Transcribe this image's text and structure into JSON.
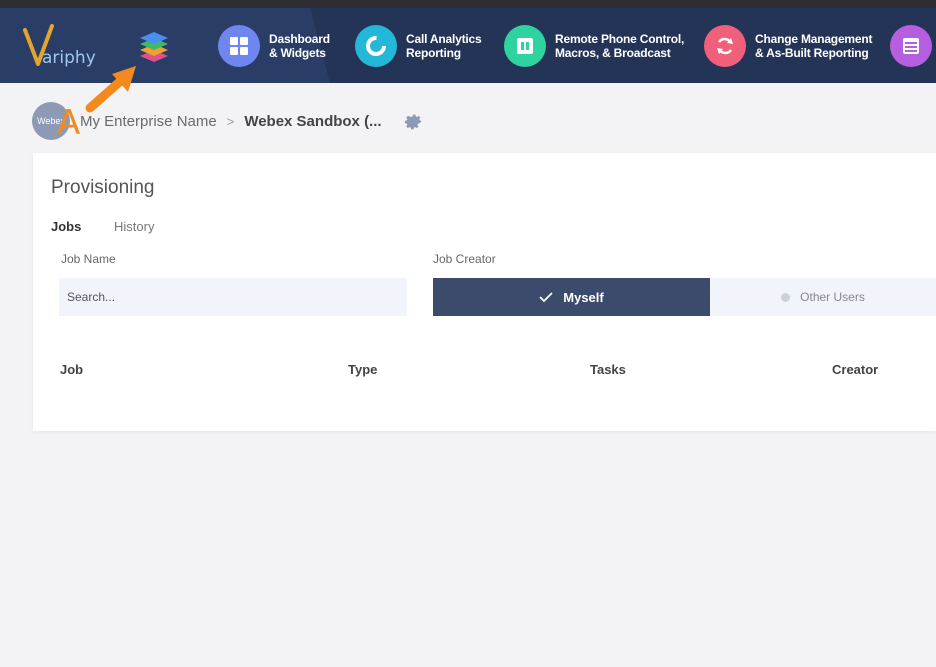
{
  "brand": {
    "logo_text": "ariphy",
    "logo_initial": "V"
  },
  "nav": {
    "items": [
      {
        "line1": "Dashboard",
        "line2": "& Widgets",
        "icon": "dashboard-icon",
        "color": "#6f86f0"
      },
      {
        "line1": "Call Analytics",
        "line2": "Reporting",
        "icon": "analytics-icon",
        "color": "#24b8d8"
      },
      {
        "line1": "Remote Phone Control,",
        "line2": "Macros, & Broadcast",
        "icon": "phone-control-icon",
        "color": "#2fd3a0"
      },
      {
        "line1": "Change Management",
        "line2": "& As-Built Reporting",
        "icon": "change-management-icon",
        "color": "#f0607a"
      },
      {
        "line1": "",
        "line2": "",
        "icon": "table-icon",
        "color": "#b65ee0"
      }
    ]
  },
  "breadcrumb": {
    "avatar_text": "Webex",
    "enterprise": "My Enterprise Name",
    "separator": ">",
    "current": "Webex Sandbox (..."
  },
  "annotation": {
    "label": "A",
    "color": "#f28a1e"
  },
  "provisioning": {
    "title": "Provisioning",
    "tabs": {
      "jobs": "Jobs",
      "history": "History"
    },
    "job_name_label": "Job Name",
    "search_placeholder": "Search...",
    "job_creator_label": "Job Creator",
    "myself": "Myself",
    "other_users": "Other Users",
    "columns": {
      "job": "Job",
      "type": "Type",
      "tasks": "Tasks",
      "creator": "Creator"
    }
  }
}
